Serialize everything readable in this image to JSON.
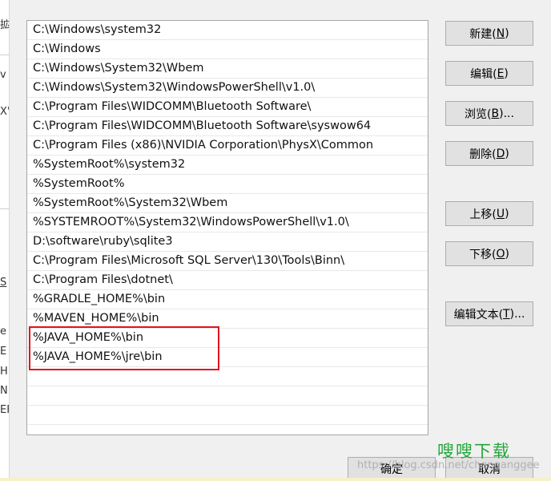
{
  "background_window": {
    "fragments": [
      "拡",
      "v",
      "X'",
      "S",
      "e",
      "E",
      "H",
      "N",
      "EF"
    ]
  },
  "path_list": [
    "C:\\Windows\\system32",
    "C:\\Windows",
    "C:\\Windows\\System32\\Wbem",
    "C:\\Windows\\System32\\WindowsPowerShell\\v1.0\\",
    "C:\\Program Files\\WIDCOMM\\Bluetooth Software\\",
    "C:\\Program Files\\WIDCOMM\\Bluetooth Software\\syswow64",
    "C:\\Program Files (x86)\\NVIDIA Corporation\\PhysX\\Common",
    "%SystemRoot%\\system32",
    "%SystemRoot%",
    "%SystemRoot%\\System32\\Wbem",
    "%SYSTEMROOT%\\System32\\WindowsPowerShell\\v1.0\\",
    "D:\\software\\ruby\\sqlite3",
    "C:\\Program Files\\Microsoft SQL Server\\130\\Tools\\Binn\\",
    "C:\\Program Files\\dotnet\\",
    "%GRADLE_HOME%\\bin",
    "%MAVEN_HOME%\\bin",
    "%JAVA_HOME%\\bin",
    "%JAVA_HOME%\\jre\\bin",
    "",
    "",
    ""
  ],
  "highlight_color": "#e0141e",
  "buttons": {
    "new": {
      "label": "新建(",
      "accel": "N",
      "suffix": ")"
    },
    "edit": {
      "label": "编辑(",
      "accel": "E",
      "suffix": ")"
    },
    "browse": {
      "label": "浏览(",
      "accel": "B",
      "suffix": ")..."
    },
    "delete": {
      "label": "删除(",
      "accel": "D",
      "suffix": ")"
    },
    "move_up": {
      "label": "上移(",
      "accel": "U",
      "suffix": ")"
    },
    "move_down": {
      "label": "下移(",
      "accel": "O",
      "suffix": ")"
    },
    "edit_text": {
      "label": "编辑文本(",
      "accel": "T",
      "suffix": ")..."
    }
  },
  "footer": {
    "ok_label": "确定",
    "cancel_label": "取消"
  },
  "watermark": {
    "logo_text": "嗖嗖下载",
    "logo_color": "#22a63a",
    "url_text": "https://blog.csdn.net/chenganggee"
  }
}
